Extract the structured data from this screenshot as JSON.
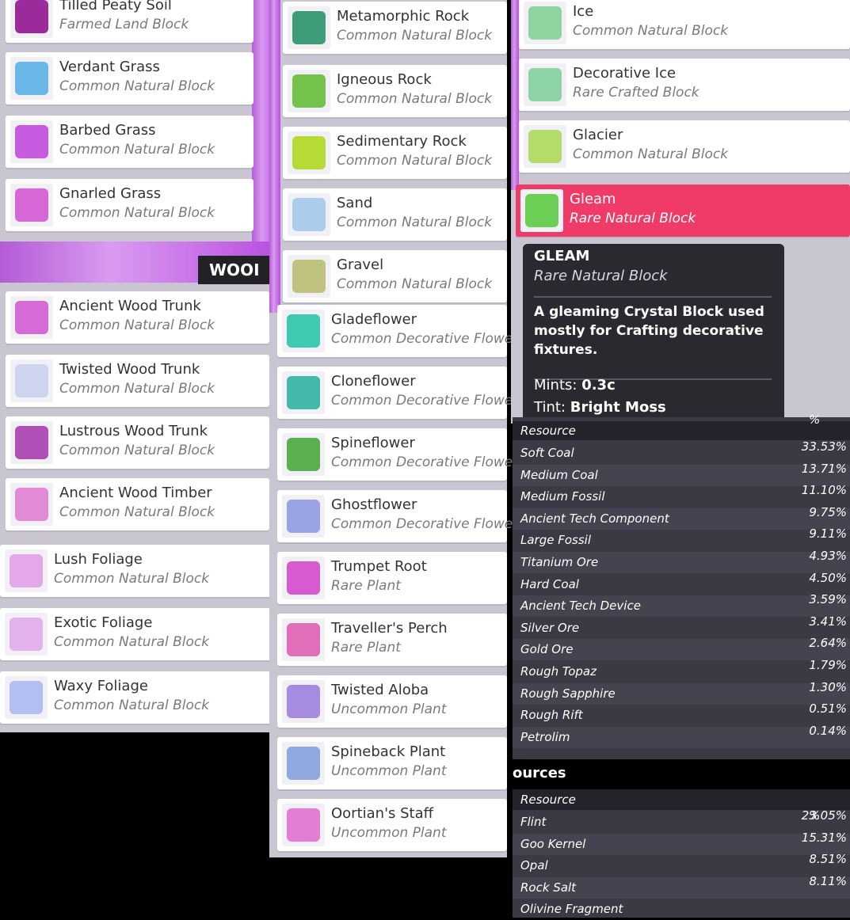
{
  "column1": {
    "tab_label": "WOOI",
    "items": [
      {
        "name": "Tilled Peaty Soil",
        "subtitle": "Farmed Land Block",
        "color": "#9b2a9a"
      },
      {
        "name": "Verdant Grass",
        "subtitle": "Common Natural Block",
        "color": "#6bb6e8"
      },
      {
        "name": "Barbed Grass",
        "subtitle": "Common Natural Block",
        "color": "#c75be0"
      },
      {
        "name": "Gnarled Grass",
        "subtitle": "Common Natural Block",
        "color": "#d767d6"
      },
      {
        "name": "Ancient Wood Trunk",
        "subtitle": "Common Natural Block",
        "color": "#d66bd8"
      },
      {
        "name": "Twisted Wood Trunk",
        "subtitle": "Common Natural Block",
        "color": "#cfd4ee"
      },
      {
        "name": "Lustrous Wood Trunk",
        "subtitle": "Common Natural Block",
        "color": "#b04fb6"
      },
      {
        "name": "Ancient Wood Timber",
        "subtitle": "Common Natural Block",
        "color": "#e38ad7"
      },
      {
        "name": "Lush Foliage",
        "subtitle": "Common Natural Block",
        "color": "#e4a8ea"
      },
      {
        "name": "Exotic Foliage",
        "subtitle": "Common Natural Block",
        "color": "#e3b1ec"
      },
      {
        "name": "Waxy Foliage",
        "subtitle": "Common Natural Block",
        "color": "#b3bff0"
      }
    ]
  },
  "column2": {
    "items": [
      {
        "name": "Metamorphic Rock",
        "subtitle": "Common Natural Block",
        "color": "#3e9c78"
      },
      {
        "name": "Igneous Rock",
        "subtitle": "Common Natural Block",
        "color": "#74c24c"
      },
      {
        "name": "Sedimentary Rock",
        "subtitle": "Common Natural Block",
        "color": "#b7db35"
      },
      {
        "name": "Sand",
        "subtitle": "Common Natural Block",
        "color": "#a9cdeb"
      },
      {
        "name": "Gravel",
        "subtitle": "Common Natural Block",
        "color": "#bfc37f"
      },
      {
        "name": "Gladeflower",
        "subtitle": "Common Decorative Flowe",
        "color": "#3fc9b0"
      },
      {
        "name": "Cloneflower",
        "subtitle": "Common Decorative Flowe",
        "color": "#42b9a9"
      },
      {
        "name": "Spineflower",
        "subtitle": "Common Decorative Flowe",
        "color": "#5ab04e"
      },
      {
        "name": "Ghostflower",
        "subtitle": "Common Decorative Flowe",
        "color": "#9aa3e6"
      },
      {
        "name": "Trumpet Root",
        "subtitle": "Rare Plant",
        "color": "#d75ad0"
      },
      {
        "name": "Traveller's Perch",
        "subtitle": "Rare Plant",
        "color": "#e06eb8"
      },
      {
        "name": "Twisted Aloba",
        "subtitle": "Uncommon Plant",
        "color": "#a78be0"
      },
      {
        "name": "Spineback Plant",
        "subtitle": "Uncommon Plant",
        "color": "#8fa8e0"
      },
      {
        "name": "Oortian's Staff",
        "subtitle": "Uncommon Plant",
        "color": "#e27fd4"
      }
    ]
  },
  "column3": {
    "items": [
      {
        "name": "Ice",
        "subtitle": "Common Natural Block",
        "color": "#8fd3a0"
      },
      {
        "name": "Decorative Ice",
        "subtitle": "Rare Crafted Block",
        "color": "#8ed3a8"
      },
      {
        "name": "Glacier",
        "subtitle": "Common Natural Block",
        "color": "#b4dc6b"
      },
      {
        "name": "Gleam",
        "subtitle": "Rare Natural Block",
        "color": "#6ccf55",
        "selected": true
      }
    ]
  },
  "tooltip": {
    "title": "GLEAM",
    "subtitle": "Rare Natural Block",
    "description": "A gleaming Crystal Block used mostly for Crafting decorative fixtures.",
    "mints_label": "Mints:",
    "mints_value": "0.3c",
    "tint_label": "Tint:",
    "tint_value": "Bright Moss"
  },
  "resource_table_1": {
    "header_resource": "Resource",
    "header_pct": "%",
    "rows": [
      {
        "name": "Soft Coal",
        "pct": "33.53%"
      },
      {
        "name": "Medium Coal",
        "pct": "13.71%"
      },
      {
        "name": "Medium Fossil",
        "pct": "11.10%"
      },
      {
        "name": "Ancient Tech Component",
        "pct": "9.75%"
      },
      {
        "name": "Large Fossil",
        "pct": "9.11%"
      },
      {
        "name": "Titanium Ore",
        "pct": "4.93%"
      },
      {
        "name": "Hard Coal",
        "pct": "4.50%"
      },
      {
        "name": "Ancient Tech Device",
        "pct": "3.59%"
      },
      {
        "name": "Silver Ore",
        "pct": "3.41%"
      },
      {
        "name": "Gold Ore",
        "pct": "2.64%"
      },
      {
        "name": "Rough Topaz",
        "pct": "1.79%"
      },
      {
        "name": "Rough Sapphire",
        "pct": "1.30%"
      },
      {
        "name": "Rough Rift",
        "pct": "0.51%"
      },
      {
        "name": "Petrolim",
        "pct": "0.14%"
      }
    ]
  },
  "section_title": "ources",
  "resource_table_2": {
    "header_resource": "Resource",
    "header_pct": "%",
    "rows": [
      {
        "name": "Flint",
        "pct": "23.05%"
      },
      {
        "name": "Goo Kernel",
        "pct": "15.31%"
      },
      {
        "name": "Opal",
        "pct": "8.51%"
      },
      {
        "name": "Rock Salt",
        "pct": "8.11%"
      },
      {
        "name": "Olivine Fragment",
        "pct": ""
      }
    ]
  }
}
